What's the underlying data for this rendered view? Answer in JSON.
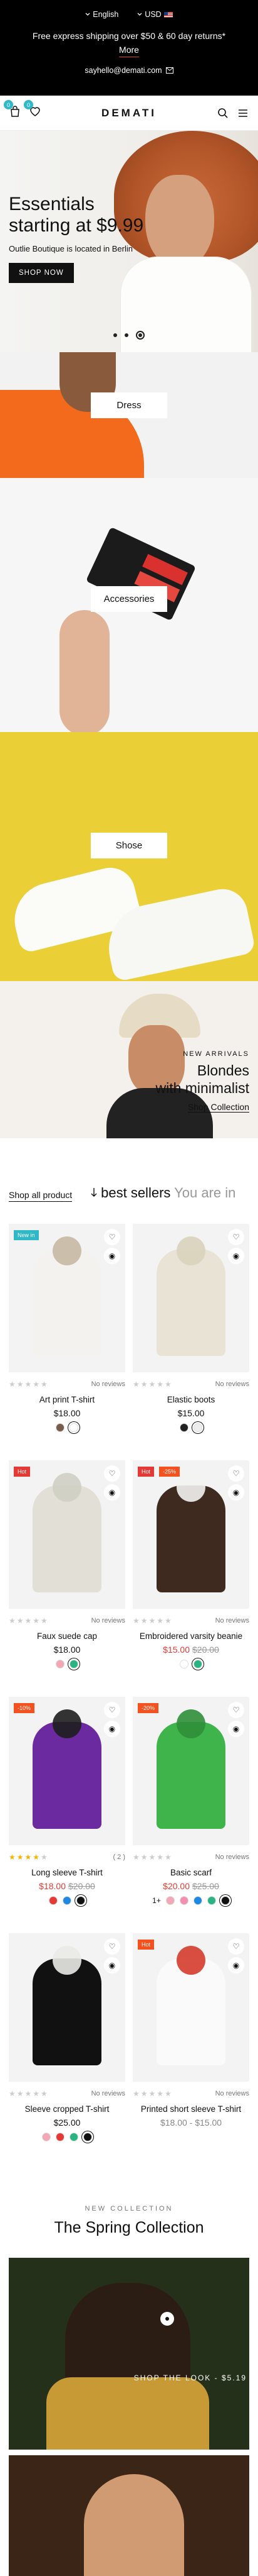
{
  "topbar": {
    "language": "English",
    "currency": "USD",
    "shipping_line1": "Free express shipping over $50 & 60 day returns*",
    "shipping_more": "More",
    "email": "sayhello@demati.com"
  },
  "header": {
    "cart_count": "0",
    "wishlist_count": "0",
    "logo": "DEMATI"
  },
  "hero": {
    "title_line1": "Essentials",
    "title_line2": "starting at $9.99",
    "subtitle": "Outlie Boutique is located in Berlin",
    "button": "SHOP NOW",
    "slides": 3,
    "active_slide": 3
  },
  "categories": [
    {
      "label": "Dress"
    },
    {
      "label": "Accessories"
    },
    {
      "label": "Shose"
    }
  ],
  "arrivals": {
    "kicker": "NEW ARRIVALS",
    "title_line1": "Blondes",
    "title_line2": "with minimalist",
    "link": "Shop Collection"
  },
  "bestsellers": {
    "shop_all": "Shop all product",
    "title": "best sellers",
    "title_faded": "You are in",
    "products": [
      {
        "tag": "New in",
        "tag_color": "#2fb8c7",
        "reviews": "No reviews",
        "rating": 0,
        "name": "Art print T-shirt",
        "price": "$18.00",
        "swatches": [
          "#7a5c4a",
          "#ffffff"
        ],
        "selected": 1
      },
      {
        "tag": "",
        "tag_color": "",
        "reviews": "No reviews",
        "rating": 0,
        "name": "Elastic boots",
        "price": "$15.00",
        "swatches": [
          "#222222",
          "#eeeeee"
        ],
        "selected": 1
      },
      {
        "tag": "Hot",
        "tag_color": "#e53935",
        "reviews": "No reviews",
        "rating": 0,
        "name": "Faux suede cap",
        "price": "$18.00",
        "swatches": [
          "#f1a7b5",
          "#2ab383"
        ],
        "selected": 1
      },
      {
        "tag": "Hot",
        "tag_color": "#e53935",
        "tag2": "-25%",
        "tag2_color": "#f4511e",
        "reviews": "No reviews",
        "rating": 0,
        "name": "Embroidered varsity beanie",
        "price_sale": "$15.00",
        "price_old": "$20.00",
        "swatches": [
          "#ffffff",
          "#2ab383"
        ],
        "selected": 1
      },
      {
        "tag": "-10%",
        "tag_color": "#f4511e",
        "reviews": "( 2 )",
        "rating": 4,
        "name": "Long sleeve T-shirt",
        "price_sale": "$18.00",
        "price_old": "$20.00",
        "swatches": [
          "#e53935",
          "#1e88e5",
          "#111111"
        ],
        "selected": 2
      },
      {
        "tag": "-20%",
        "tag_color": "#f4511e",
        "reviews": "No reviews",
        "rating": 0,
        "name": "Basic scarf",
        "price_sale": "$20.00",
        "price_old": "$25.00",
        "swatches_more": "1+",
        "swatches": [
          "#f1a7b5",
          "#f48fb1",
          "#1e88e5",
          "#2ab383",
          "#111111"
        ],
        "selected": 4
      },
      {
        "tag": "",
        "tag_color": "",
        "reviews": "No reviews",
        "rating": 0,
        "name": "Sleeve cropped T-shirt",
        "price": "$25.00",
        "swatches": [
          "#f1a7b5",
          "#e53935",
          "#2ab383",
          "#111111"
        ],
        "selected": 3
      },
      {
        "tag": "Hot",
        "tag_color": "#f4511e",
        "reviews": "No reviews",
        "rating": 0,
        "name": "Printed short sleeve T-shirt",
        "price_range": "$18.00 - $15.00",
        "swatches": [],
        "selected": -1
      }
    ]
  },
  "spring": {
    "kicker": "NEW COLLECTION",
    "title": "The Spring Collection",
    "shop_the_look": "SHOP THE LOOK - $5.19"
  }
}
